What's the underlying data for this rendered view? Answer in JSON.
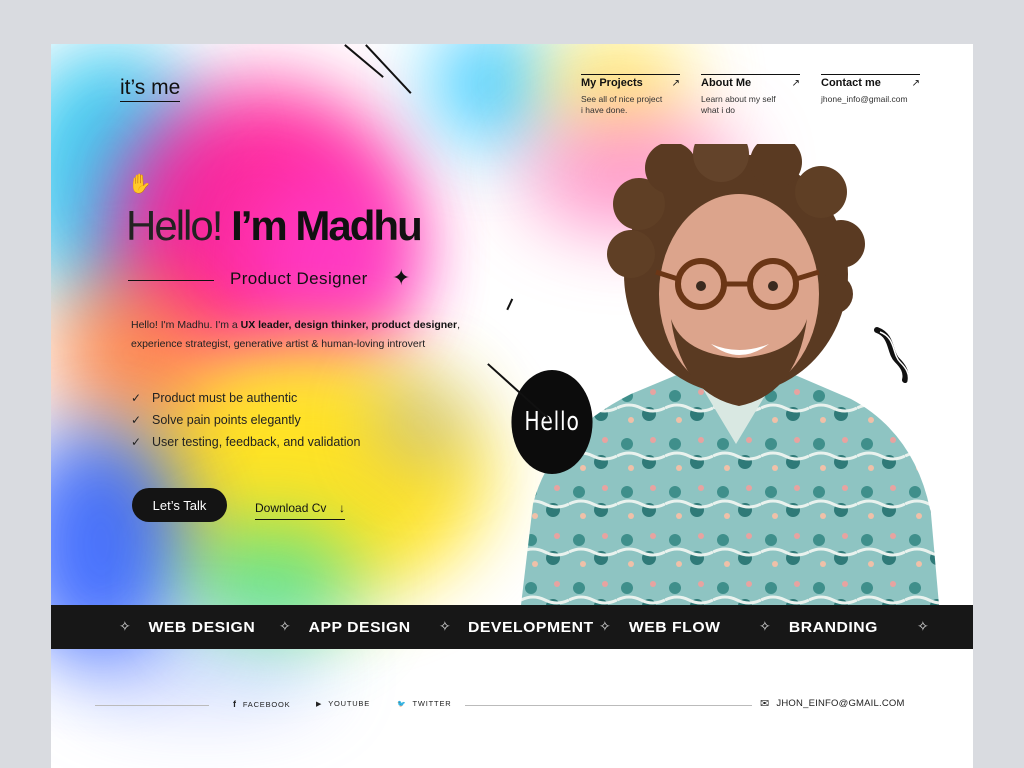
{
  "logo": "it’s me",
  "nav": [
    {
      "title": "My Projects",
      "sub1": "See all of nice project",
      "sub2": "i have done.",
      "arrow": "↗"
    },
    {
      "title": "About Me",
      "sub1": "Learn about my self",
      "sub2": "what i do",
      "arrow": "↗"
    },
    {
      "title": "Contact me",
      "sub1": "jhone_info@gmail.com",
      "sub2": "",
      "arrow": "↗"
    }
  ],
  "hero": {
    "hand_icon": "✋",
    "greeting": "Hello!",
    "name": "I’m Madhu",
    "role": "Product Designer",
    "spark_icon": "✦",
    "bio_1": "Hello! I'm Madhu. I'm a ",
    "bio_bold": "UX leader, design thinker, product designer",
    "bio_2": ",",
    "bio_3": "experience strategist, generative artist & human-loving introvert",
    "checks": [
      "Product must be authentic",
      "Solve pain points elegantly",
      "User testing, feedback, and validation"
    ],
    "check_icon": "✓",
    "talk_button": "Let’s Talk",
    "cv_button": "Download Cv",
    "cv_arrow": "↓",
    "hello_badge": "Hello"
  },
  "ticker": {
    "items": [
      "WEB DESIGN",
      "APP DESIGN",
      "DEVELOPMENT",
      "WEB FLOW",
      "BRANDING"
    ],
    "star": "✧"
  },
  "footer": {
    "links": [
      {
        "icon": "f",
        "label": "FACEBOOK"
      },
      {
        "icon": "▶",
        "label": "YOUTUBE"
      },
      {
        "icon": "🐦",
        "label": "TWITTER"
      }
    ],
    "email": "JHON_EINFO@GMAIL.COM",
    "mail_icon": "✉"
  },
  "colors": {
    "dark": "#141414",
    "pink": "#ff1493",
    "yellow": "#ffe21a",
    "cyan": "#2fc7f0",
    "blue": "#2a5bff",
    "shirt": "#8fc4c4"
  }
}
